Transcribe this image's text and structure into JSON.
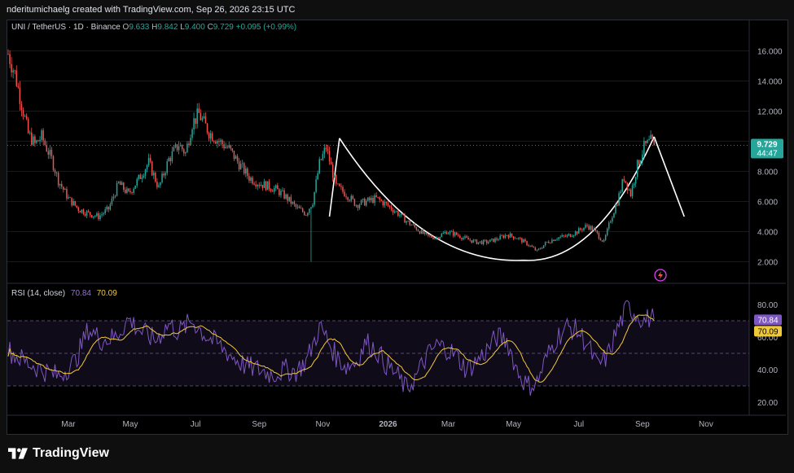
{
  "header": {
    "credit": "nderitumichaelg created with TradingView.com, Sep 26, 2026 23:15 UTC"
  },
  "legend": {
    "symbol": "UNI / TetherUS · 1D · Binance",
    "o_label": "O",
    "o_value": "9.633",
    "h_label": "H",
    "h_value": "9.842",
    "l_label": "L",
    "l_value": "9.400",
    "c_label": "C",
    "c_value": "9.729",
    "change": "+0.095 (+0.99%)"
  },
  "rsi_legend": {
    "label": "RSI (14, close)",
    "rsi_value": "70.84",
    "ma_value": "70.09"
  },
  "price_axis": {
    "ticks": [
      "16.000",
      "14.000",
      "12.000",
      "10.000",
      "8.000",
      "6.000",
      "4.000",
      "2.000"
    ],
    "current_price": "9.729",
    "countdown": "44:47"
  },
  "rsi_axis": {
    "ticks": [
      "80.00",
      "60.00",
      "40.00",
      "20.00"
    ],
    "rsi_badge": "70.84",
    "ma_badge": "70.09"
  },
  "time_axis": {
    "labels": [
      "Mar",
      "May",
      "Jul",
      "Sep",
      "Nov",
      "2026",
      "Mar",
      "May",
      "Jul",
      "Sep",
      "Nov"
    ]
  },
  "footer": {
    "brand": "TradingView"
  },
  "colors": {
    "up": "#26a69a",
    "down": "#ef5350",
    "rsi": "#7e57c2",
    "rsi_ma": "#f0c93b",
    "pattern": "#ffffff",
    "price_badge": "#26a69a",
    "rsi_badge": "#7e57c2",
    "ma_badge": "#f0c93b"
  },
  "chart_data": {
    "type": "candlestick",
    "price_anchors": [
      [
        0,
        15.8
      ],
      [
        4,
        14.5
      ],
      [
        8,
        12.5
      ],
      [
        12,
        10.5
      ],
      [
        16,
        9.8
      ],
      [
        20,
        10.3
      ],
      [
        26,
        8.8
      ],
      [
        30,
        7.4
      ],
      [
        36,
        6.2
      ],
      [
        42,
        5.5
      ],
      [
        48,
        5.2
      ],
      [
        54,
        5.0
      ],
      [
        60,
        5.5
      ],
      [
        66,
        7.2
      ],
      [
        72,
        6.5
      ],
      [
        78,
        7.5
      ],
      [
        84,
        8.6
      ],
      [
        90,
        6.9
      ],
      [
        96,
        8.8
      ],
      [
        102,
        9.8
      ],
      [
        106,
        9.2
      ],
      [
        110,
        11.2
      ],
      [
        114,
        11.8
      ],
      [
        120,
        10.6
      ],
      [
        126,
        10.0
      ],
      [
        132,
        9.5
      ],
      [
        138,
        8.5
      ],
      [
        144,
        7.6
      ],
      [
        150,
        7.2
      ],
      [
        156,
        7.0
      ],
      [
        160,
        6.8
      ],
      [
        166,
        6.3
      ],
      [
        172,
        5.6
      ],
      [
        178,
        5.2
      ],
      [
        182,
        6.0
      ],
      [
        186,
        8.5
      ],
      [
        190,
        9.6
      ],
      [
        196,
        7.0
      ],
      [
        202,
        6.5
      ],
      [
        208,
        5.8
      ],
      [
        214,
        6.0
      ],
      [
        220,
        6.2
      ],
      [
        226,
        5.8
      ],
      [
        232,
        5.3
      ],
      [
        238,
        4.7
      ],
      [
        244,
        4.2
      ],
      [
        250,
        3.7
      ],
      [
        256,
        3.6
      ],
      [
        262,
        4.0
      ],
      [
        268,
        3.8
      ],
      [
        274,
        3.5
      ],
      [
        280,
        3.3
      ],
      [
        286,
        3.3
      ],
      [
        292,
        3.5
      ],
      [
        298,
        3.8
      ],
      [
        304,
        3.6
      ],
      [
        310,
        3.2
      ],
      [
        316,
        2.7
      ],
      [
        322,
        3.3
      ],
      [
        328,
        3.6
      ],
      [
        334,
        3.7
      ],
      [
        340,
        4.0
      ],
      [
        346,
        4.4
      ],
      [
        350,
        4.1
      ],
      [
        356,
        3.3
      ],
      [
        360,
        4.8
      ],
      [
        364,
        6.0
      ],
      [
        368,
        7.6
      ],
      [
        372,
        6.5
      ],
      [
        376,
        8.4
      ],
      [
        380,
        9.6
      ],
      [
        384,
        10.0
      ],
      [
        386,
        9.729
      ]
    ],
    "rsi_anchors": [
      [
        0,
        52
      ],
      [
        10,
        45
      ],
      [
        20,
        40
      ],
      [
        30,
        36
      ],
      [
        40,
        45
      ],
      [
        48,
        65
      ],
      [
        56,
        58
      ],
      [
        64,
        60
      ],
      [
        72,
        71
      ],
      [
        80,
        63
      ],
      [
        88,
        58
      ],
      [
        96,
        68
      ],
      [
        102,
        63
      ],
      [
        110,
        70
      ],
      [
        118,
        61
      ],
      [
        126,
        55
      ],
      [
        134,
        48
      ],
      [
        142,
        42
      ],
      [
        150,
        40
      ],
      [
        158,
        37
      ],
      [
        166,
        40
      ],
      [
        172,
        39
      ],
      [
        178,
        45
      ],
      [
        182,
        55
      ],
      [
        186,
        66
      ],
      [
        190,
        60
      ],
      [
        196,
        48
      ],
      [
        202,
        42
      ],
      [
        208,
        45
      ],
      [
        214,
        57
      ],
      [
        220,
        52
      ],
      [
        226,
        43
      ],
      [
        232,
        37
      ],
      [
        238,
        28
      ],
      [
        244,
        36
      ],
      [
        250,
        48
      ],
      [
        256,
        55
      ],
      [
        262,
        53
      ],
      [
        268,
        48
      ],
      [
        274,
        40
      ],
      [
        280,
        45
      ],
      [
        286,
        52
      ],
      [
        292,
        60
      ],
      [
        298,
        58
      ],
      [
        304,
        40
      ],
      [
        310,
        30
      ],
      [
        316,
        32
      ],
      [
        322,
        48
      ],
      [
        328,
        60
      ],
      [
        334,
        66
      ],
      [
        340,
        64
      ],
      [
        346,
        56
      ],
      [
        352,
        42
      ],
      [
        358,
        48
      ],
      [
        364,
        65
      ],
      [
        370,
        78
      ],
      [
        376,
        74
      ],
      [
        380,
        70
      ],
      [
        384,
        72
      ],
      [
        386,
        70.84
      ]
    ],
    "rsi_ma_last": 70.09,
    "rsi_bands": [
      70,
      50,
      30
    ],
    "price_ylim": [
      1.0,
      17.0
    ],
    "rsi_ylim": [
      10,
      90
    ],
    "bars": 387,
    "spike_low": {
      "bar": 181,
      "value": 2.0
    },
    "pattern": {
      "left_rim": {
        "bar": 198,
        "price": 10.2
      },
      "bottom": {
        "bar": 308,
        "price": 2.1
      },
      "right_rim": {
        "bar": 386,
        "price": 10.3
      },
      "left_start": {
        "bar": 192,
        "price": 5.0
      },
      "right_end": {
        "bar": 404,
        "price": 5.0
      }
    }
  }
}
